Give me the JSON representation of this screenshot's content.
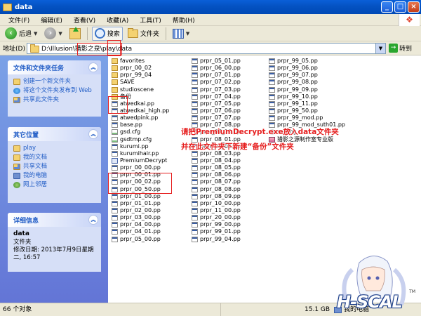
{
  "window": {
    "title": "data"
  },
  "menu": [
    "文件(F)",
    "编辑(E)",
    "查看(V)",
    "收藏(A)",
    "工具(T)",
    "帮助(H)"
  ],
  "toolbar": {
    "back": "后退",
    "search": "搜索",
    "folders": "文件夹"
  },
  "address": {
    "label": "地址(D)",
    "path": "D:\\Illusion\\猎影之泉\\play\\data",
    "go": "转到"
  },
  "tasks": {
    "title": "文件和文件夹任务",
    "items": [
      "创建一个新文件夹",
      "将这个文件夹发布到 Web",
      "共享此文件夹"
    ]
  },
  "places": {
    "title": "其它位置",
    "items": [
      "play",
      "我的文档",
      "共享文档",
      "我的电脑",
      "网上邻居"
    ]
  },
  "details": {
    "title": "详细信息",
    "name": "data",
    "type": "文件夹",
    "modified": "修改日期: 2013年7月9日星期二, 16:57"
  },
  "files": {
    "col1": [
      {
        "name": "favorites",
        "icon": "folder"
      },
      {
        "name": "prpr_00_02",
        "icon": "folder"
      },
      {
        "name": "prpr_99_04",
        "icon": "folder"
      },
      {
        "name": "SAVE",
        "icon": "folder"
      },
      {
        "name": "studioscene",
        "icon": "folder"
      },
      {
        "name": "备份",
        "icon": "folder"
      },
      {
        "name": "atwedkai.pp",
        "icon": "pp"
      },
      {
        "name": "atwedkai_high.pp",
        "icon": "pp"
      },
      {
        "name": "atwedpink.pp",
        "icon": "pp"
      },
      {
        "name": "base.pp",
        "icon": "pp"
      },
      {
        "name": "gsd.cfg",
        "icon": "cfg"
      },
      {
        "name": "gsdtmp.cfg",
        "icon": "cfg"
      },
      {
        "name": "kurumi.pp",
        "icon": "pp"
      },
      {
        "name": "kurumihair.pp",
        "icon": "pp"
      },
      {
        "name": "PremiumDecrypt",
        "icon": "exe"
      },
      {
        "name": "prpr_00_00.pp",
        "icon": "pp"
      },
      {
        "name": "prpr_00_01.pp",
        "icon": "pp"
      },
      {
        "name": "prpr_00_02.pp",
        "icon": "pp"
      },
      {
        "name": "prpr_00_50.pp",
        "icon": "pp"
      },
      {
        "name": "prpr_01_00.pp",
        "icon": "pp"
      },
      {
        "name": "prpr_01_01.pp",
        "icon": "pp"
      },
      {
        "name": "prpr_02_00.pp",
        "icon": "pp"
      },
      {
        "name": "prpr_03_00.pp",
        "icon": "pp"
      },
      {
        "name": "prpr_04_00.pp",
        "icon": "pp"
      },
      {
        "name": "prpr_04_01.pp",
        "icon": "pp"
      },
      {
        "name": "prpr_05_00.pp",
        "icon": "pp"
      }
    ],
    "col2": [
      {
        "name": "prpr_05_01.pp",
        "icon": "pp"
      },
      {
        "name": "prpr_06_00.pp",
        "icon": "pp"
      },
      {
        "name": "prpr_07_01.pp",
        "icon": "pp"
      },
      {
        "name": "prpr_07_02.pp",
        "icon": "pp"
      },
      {
        "name": "prpr_07_03.pp",
        "icon": "pp"
      },
      {
        "name": "prpr_07_04.pp",
        "icon": "pp"
      },
      {
        "name": "prpr_07_05.pp",
        "icon": "pp"
      },
      {
        "name": "prpr_07_06.pp",
        "icon": "pp"
      },
      {
        "name": "prpr_07_07.pp",
        "icon": "pp"
      },
      {
        "name": "prpr_07_08.pp",
        "icon": "pp"
      },
      {
        "name": "prpr_07_10.pp",
        "icon": "pp"
      },
      {
        "name": "prpr_08_01.pp",
        "icon": "pp"
      },
      {
        "name": "prpr_08_02.pp",
        "icon": "pp"
      },
      {
        "name": "prpr_08_03.pp",
        "icon": "pp"
      },
      {
        "name": "prpr_08_04.pp",
        "icon": "pp"
      },
      {
        "name": "prpr_08_05.pp",
        "icon": "pp"
      },
      {
        "name": "prpr_08_06.pp",
        "icon": "pp"
      },
      {
        "name": "prpr_08_07.pp",
        "icon": "pp"
      },
      {
        "name": "prpr_08_08.pp",
        "icon": "pp"
      },
      {
        "name": "prpr_08_09.pp",
        "icon": "pp"
      },
      {
        "name": "prpr_10_00.pp",
        "icon": "pp"
      },
      {
        "name": "prpr_11_00.pp",
        "icon": "pp"
      },
      {
        "name": "prpr_20_00.pp",
        "icon": "pp"
      },
      {
        "name": "prpr_99_00.pp",
        "icon": "pp"
      },
      {
        "name": "prpr_99_01.pp",
        "icon": "pp"
      },
      {
        "name": "prpr_99_04.pp",
        "icon": "pp"
      }
    ],
    "col3": [
      {
        "name": "prpr_99_05.pp",
        "icon": "pp"
      },
      {
        "name": "prpr_99_06.pp",
        "icon": "pp"
      },
      {
        "name": "prpr_99_07.pp",
        "icon": "pp"
      },
      {
        "name": "prpr_99_08.pp",
        "icon": "pp"
      },
      {
        "name": "prpr_99_09.pp",
        "icon": "pp"
      },
      {
        "name": "prpr_99_10.pp",
        "icon": "pp"
      },
      {
        "name": "prpr_99_11.pp",
        "icon": "pp"
      },
      {
        "name": "prpr_99_50.pp",
        "icon": "pp"
      },
      {
        "name": "prpr_99_mod.pp",
        "icon": "pp"
      },
      {
        "name": "prpr_99_mod_suth01.pp",
        "icon": "pp"
      },
      {
        "name": "setting",
        "icon": "set"
      },
      {
        "name": "猎影之源制作室专业版",
        "icon": "app"
      }
    ]
  },
  "annotation": {
    "line1": "请把PremiumDecrypt.exe放入data文件夹",
    "line2": "并在此文件夹下新建“备份”文件夹"
  },
  "status": {
    "count": "66 个对象",
    "size": "15.1 GB",
    "location": "我的电脑"
  },
  "watermark": {
    "text": "H-SCAL",
    "tm": "TM"
  },
  "colors": {
    "title_blue": "#0452c2",
    "task_blue": "#215dc6",
    "annotation_red": "#e61e1e",
    "folder_yellow": "#f4d270"
  }
}
